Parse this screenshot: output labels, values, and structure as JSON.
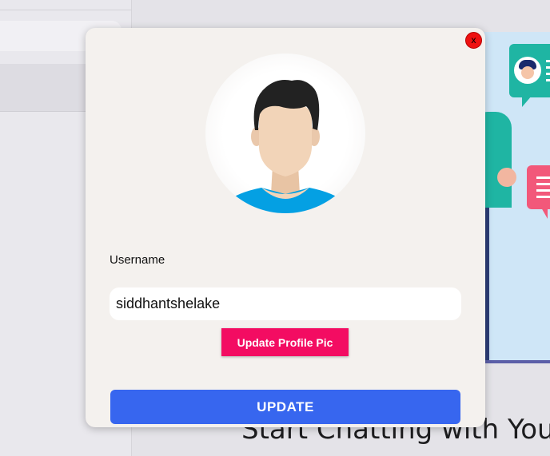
{
  "background": {
    "heading": "Start Chatting with You"
  },
  "modal": {
    "close_label": "x",
    "avatar_icon": "user-avatar-icon",
    "username_label": "Username",
    "username_value": "siddhantshelake",
    "upload_label": "Update Profile Pic",
    "update_label": "UPDATE"
  },
  "colors": {
    "modal_bg": "#f4f1ee",
    "close": "#ee1111",
    "upload_button": "#f30c62",
    "update_button": "#3766ef",
    "avatar_shirt": "#04a0e3",
    "avatar_hair": "#222222",
    "avatar_skin": "#f2d4b8"
  }
}
